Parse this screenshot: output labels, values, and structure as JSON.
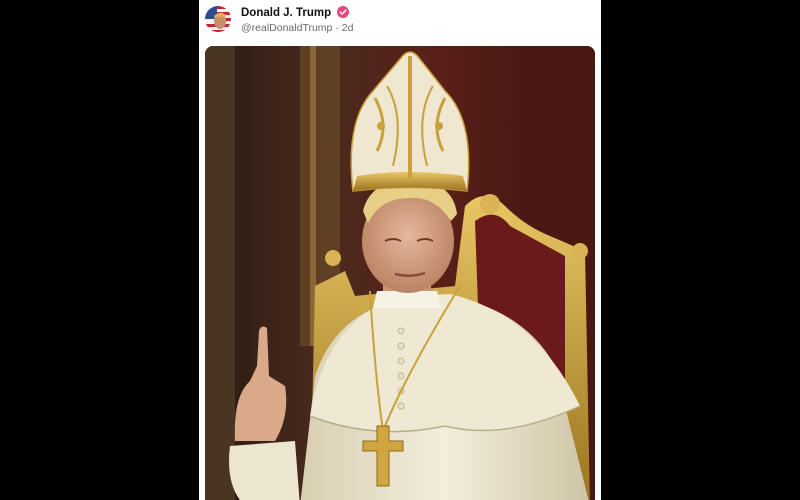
{
  "post": {
    "author": {
      "display_name": "Donald J. Trump",
      "handle": "@realDonaldTrump",
      "age": "2d",
      "separator": "·",
      "verified_icon": "verified-check-icon"
    },
    "image": {
      "subject": "figure in papal vestments and golden mitre raising index finger",
      "colors": {
        "background_dark": "#3a1a16",
        "gold": "#c9a13b",
        "robe": "#ece6cf",
        "mitre": "#efe7d0"
      }
    },
    "colors": {
      "verified_badge": "#e8467c",
      "page_background": "#000000",
      "card_background": "#ffffff"
    }
  }
}
